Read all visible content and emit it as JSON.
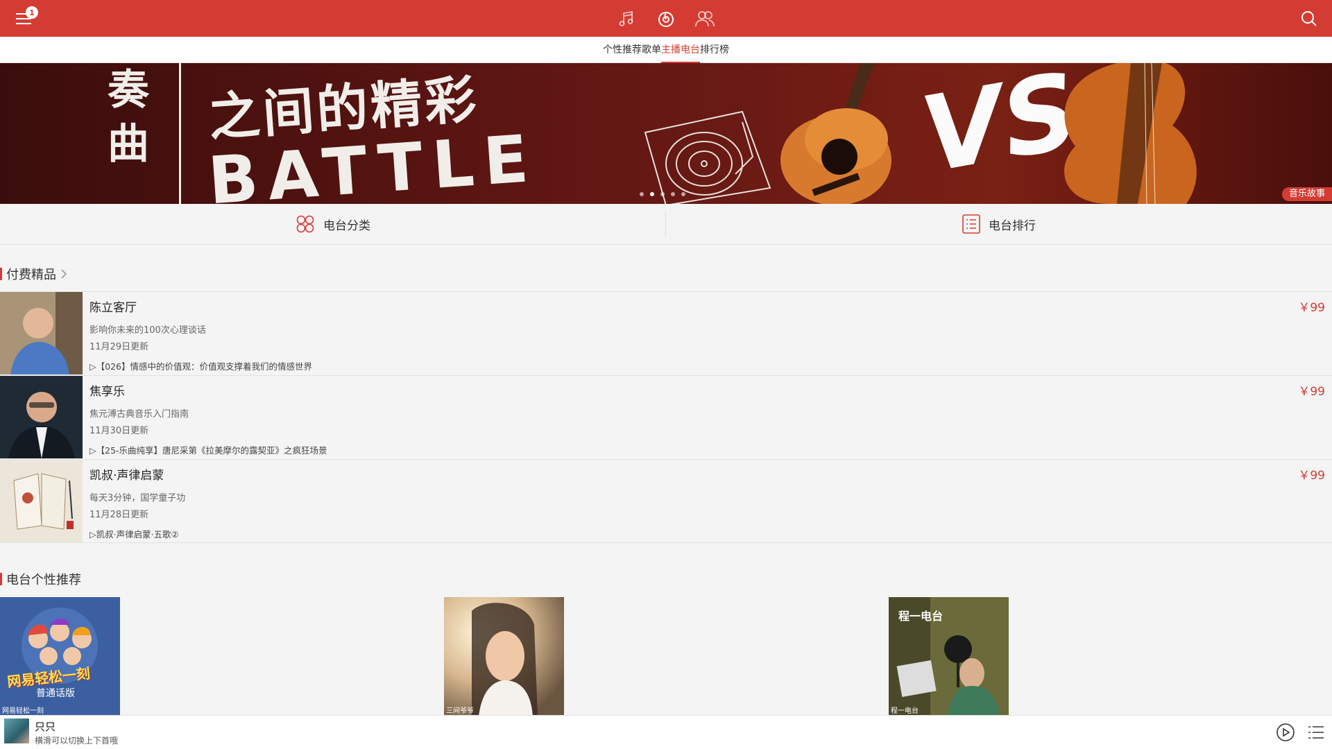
{
  "topbar": {
    "badge_count": "1",
    "icons": [
      "menu-icon",
      "music-note-icon",
      "radio-icon",
      "friends-icon",
      "search-icon"
    ]
  },
  "subtabs": [
    {
      "label": "个性推荐",
      "active": false
    },
    {
      "label": "歌单",
      "active": false
    },
    {
      "label": "主播电台",
      "active": true
    },
    {
      "label": "排行榜",
      "active": false
    }
  ],
  "banner": {
    "line1": "之间的精彩",
    "line2": "BATTLE",
    "side": "奏曲",
    "vs": "VS",
    "tag": "音乐故事",
    "dots": 5,
    "active_dot": 1
  },
  "categories": {
    "category_label": "电台分类",
    "rank_label": "电台排行"
  },
  "paid_section": {
    "title": "付费精品",
    "items": [
      {
        "title": "陈立客厅",
        "subtitle": "影响你未来的100次心理谈话",
        "date": "11月29日更新",
        "episode": "▷【026】情感中的价值观：价值观支撑着我们的情感世界",
        "price": "￥99"
      },
      {
        "title": "焦享乐",
        "subtitle": "焦元溥古典音乐入门指南",
        "date": "11月30日更新",
        "episode": "▷【25-乐曲纯享】唐尼采第《拉美摩尔的露契亚》之疯狂场景",
        "price": "￥99"
      },
      {
        "title": "凯叔·声律启蒙",
        "subtitle": "每天3分钟，国学童子功",
        "date": "11月28日更新",
        "episode": "▷凯叔·声律启蒙·五歌②",
        "price": "￥99"
      }
    ]
  },
  "recommend_section": {
    "title": "电台个性推荐",
    "items": [
      {
        "label": "网易轻松一刻",
        "art_text": "网易轻松一刻",
        "art_sub": "普通话版"
      },
      {
        "label": "三间爷爷",
        "art_text": "",
        "art_sub": ""
      },
      {
        "label": "程一电台",
        "art_text": "程一电台",
        "art_sub": ""
      }
    ]
  },
  "player": {
    "title": "只只",
    "hint": "横滑可以切换上下首哦"
  }
}
